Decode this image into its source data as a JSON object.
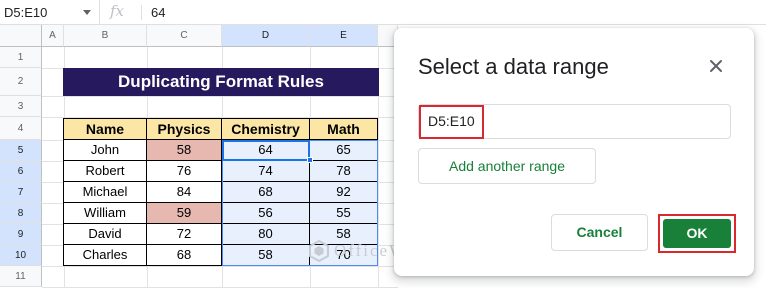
{
  "formula_bar": {
    "name_box": "D5:E10",
    "fx_symbol": "fx",
    "value": "64"
  },
  "columns": [
    "A",
    "B",
    "C",
    "D",
    "E"
  ],
  "selected_columns": [
    "D",
    "E"
  ],
  "rows": [
    "1",
    "2",
    "3",
    "4",
    "5",
    "6",
    "7",
    "8",
    "9",
    "10",
    "11"
  ],
  "selected_rows": [
    "5",
    "6",
    "7",
    "8",
    "9",
    "10"
  ],
  "sheet_title": "Duplicating Format Rules",
  "table": {
    "headers": [
      "Name",
      "Physics",
      "Chemistry",
      "Math"
    ],
    "rows": [
      [
        "John",
        "58",
        "64",
        "65"
      ],
      [
        "Robert",
        "76",
        "74",
        "78"
      ],
      [
        "Michael",
        "84",
        "68",
        "92"
      ],
      [
        "William",
        "59",
        "56",
        "55"
      ],
      [
        "David",
        "72",
        "80",
        "58"
      ],
      [
        "Charles",
        "68",
        "58",
        "70"
      ]
    ]
  },
  "dialog": {
    "title": "Select a data range",
    "range_value": "D5:E10",
    "add_range_label": "Add another range",
    "cancel_label": "Cancel",
    "ok_label": "OK"
  },
  "watermark": "OfficeWheel",
  "colors": {
    "title_bg": "#26195e",
    "header_bg": "#fbe6a6",
    "highlight_bg": "#e6b8af",
    "selection_bg": "#e8f0fe",
    "selection_border": "#1a73e8",
    "button_green": "#188038",
    "annotation_red": "#d9292f"
  }
}
